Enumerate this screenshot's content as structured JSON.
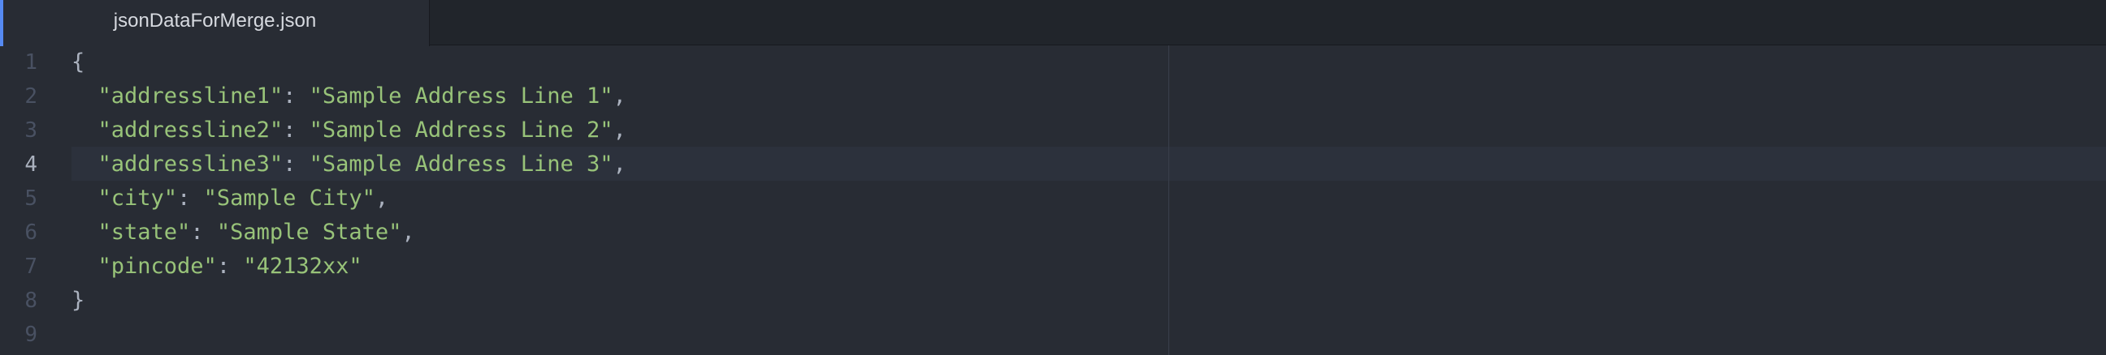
{
  "tab": {
    "title": "jsonDataForMerge.json"
  },
  "gutter": {
    "numbers": [
      "1",
      "2",
      "3",
      "4",
      "5",
      "6",
      "7",
      "8",
      "9"
    ],
    "current_line": "4"
  },
  "code": {
    "open_brace": "{",
    "close_brace": "}",
    "entries": [
      {
        "key": "\"addressline1\"",
        "sep": ": ",
        "value": "\"Sample Address Line 1\"",
        "end": ","
      },
      {
        "key": "\"addressline2\"",
        "sep": ": ",
        "value": "\"Sample Address Line 2\"",
        "end": ","
      },
      {
        "key": "\"addressline3\"",
        "sep": ": ",
        "value": "\"Sample Address Line 3\"",
        "end": ","
      },
      {
        "key": "\"city\"",
        "sep": ": ",
        "value": "\"Sample City\"",
        "end": ","
      },
      {
        "key": "\"state\"",
        "sep": ": ",
        "value": "\"Sample State\"",
        "end": ","
      },
      {
        "key": "\"pincode\"",
        "sep": ": ",
        "value": "\"42132xx\"",
        "end": ""
      }
    ]
  },
  "colors": {
    "background": "#282c34",
    "tab_bar": "#21252b",
    "accent": "#568af2",
    "string": "#98c379",
    "punctuation": "#abb2bf",
    "line_number": "#495162"
  }
}
